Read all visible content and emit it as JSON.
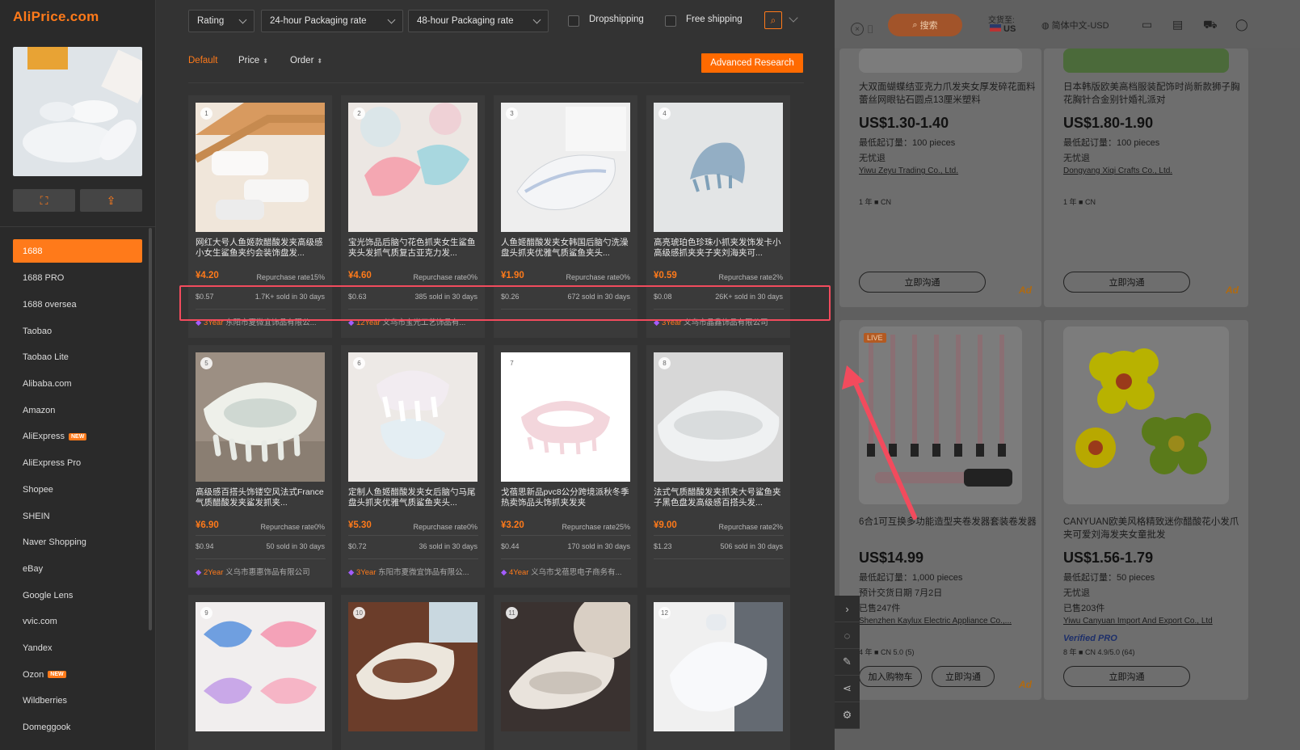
{
  "app": {
    "logo": "AliPrice.com"
  },
  "filters": {
    "rating": "Rating",
    "pack24": "24-hour Packaging rate",
    "pack48": "48-hour Packaging rate",
    "dropshipping": "Dropshipping",
    "free_shipping": "Free shipping"
  },
  "sort": {
    "default": "Default",
    "price": "Price",
    "order": "Order",
    "advanced": "Advanced Research"
  },
  "sources": [
    {
      "label": "1688",
      "active": true
    },
    {
      "label": "1688 PRO"
    },
    {
      "label": "1688 oversea"
    },
    {
      "label": "Taobao"
    },
    {
      "label": "Taobao Lite"
    },
    {
      "label": "Alibaba.com"
    },
    {
      "label": "Amazon"
    },
    {
      "label": "AliExpress",
      "badge": "NEW"
    },
    {
      "label": "AliExpress Pro"
    },
    {
      "label": "Shopee"
    },
    {
      "label": "SHEIN"
    },
    {
      "label": "Naver Shopping"
    },
    {
      "label": "eBay"
    },
    {
      "label": "Google Lens"
    },
    {
      "label": "vvic.com"
    },
    {
      "label": "Yandex"
    },
    {
      "label": "Ozon",
      "badge": "NEW"
    },
    {
      "label": "Wildberries"
    },
    {
      "label": "Domeggook"
    }
  ],
  "products": [
    {
      "num": "1",
      "title": "网红大号人鱼姬款醋酸发夹高级感小女生鲨鱼夹约会装饰盘发...",
      "price": "¥4.20",
      "repurchase": "Repurchase rate15%",
      "usd": "$0.57",
      "sold": "1.7K+ sold in 30 days",
      "years": "3Year",
      "seller": "东阳市夏微宜饰品有限公..."
    },
    {
      "num": "2",
      "title": "宝光饰品后脑勺花色抓夹女生鲨鱼夹头发抓气质复古亚克力发...",
      "price": "¥4.60",
      "repurchase": "Repurchase rate0%",
      "usd": "$0.63",
      "sold": "385 sold in 30 days",
      "years": "12Year",
      "seller": "义乌市宝光工艺饰品有..."
    },
    {
      "num": "3",
      "title": "人鱼姬醋酸发夹女韩国后脑勺洗澡盘头抓夹优雅气质鲨鱼夹头...",
      "price": "¥1.90",
      "repurchase": "Repurchase rate0%",
      "usd": "$0.26",
      "sold": "672 sold in 30 days",
      "years": "",
      "seller": ""
    },
    {
      "num": "4",
      "title": "高亮琥珀色珍珠小抓夹发饰发卡小高级感抓夹夹子夹刘海夹可...",
      "price": "¥0.59",
      "repurchase": "Repurchase rate2%",
      "usd": "$0.08",
      "sold": "26K+ sold in 30 days",
      "years": "3Year",
      "seller": "义乌市晶鑫饰品有限公司"
    },
    {
      "num": "5",
      "title": "高级感百搭头饰镂空风法式France气质醋酸发夹鲨发抓夹...",
      "price": "¥6.90",
      "repurchase": "Repurchase rate0%",
      "usd": "$0.94",
      "sold": "50 sold in 30 days",
      "years": "2Year",
      "seller": "义乌市惠惠饰品有限公司"
    },
    {
      "num": "6",
      "title": "定制人鱼姬醋酸发夹女后脑勺马尾盘头抓夹优雅气质鲨鱼夹头...",
      "price": "¥5.30",
      "repurchase": "Repurchase rate0%",
      "usd": "$0.72",
      "sold": "36 sold in 30 days",
      "years": "3Year",
      "seller": "东阳市夏微宜饰品有限公..."
    },
    {
      "num": "7",
      "title": "戈蓓思新品pvc8公分跨境派秋冬季热卖饰品头饰抓夹发夹",
      "price": "¥3.20",
      "repurchase": "Repurchase rate25%",
      "usd": "$0.44",
      "sold": "170 sold in 30 days",
      "years": "4Year",
      "seller": "义乌市戈蓓思电子商务有..."
    },
    {
      "num": "8",
      "title": "法式气质醋酸发夹抓夹大号鲨鱼夹子黑色盘发高级感百搭头发...",
      "price": "¥9.00",
      "repurchase": "Repurchase rate2%",
      "usd": "$1.23",
      "sold": "506 sold in 30 days",
      "years": "",
      "seller": ""
    },
    {
      "num": "9"
    },
    {
      "num": "10"
    },
    {
      "num": "11"
    },
    {
      "num": "12"
    }
  ],
  "web": {
    "search_btn": "搜索",
    "ship_to": "交货至:",
    "country": "US",
    "language": "简体中文-USD",
    "cards": [
      {
        "title": "大双面蝴蝶结亚克力爪发夹女厚发碎花面料蕾丝网眼钻石圆点13厘米塑料",
        "price": "US$1.30-1.40",
        "moq": "最低起订量：100 pieces",
        "note": "无忧退",
        "company": "Yiwu Zeyu Trading Co., Ltd.",
        "meta": "1 年 ■ CN",
        "btn": "立即沟通",
        "ad": "Ad"
      },
      {
        "title": "日本韩版欧美高档服装配饰时尚新款狮子胸花胸针合金别针婚礼派对",
        "price": "US$1.80-1.90",
        "moq": "最低起订量：100 pieces",
        "note": "无忧退",
        "company": "Dongyang Xiqi Crafts Co., Ltd.",
        "meta": "1 年 ■ CN",
        "btn": "立即沟通",
        "ad": "Ad"
      },
      {
        "title": "6合1可互换多功能造型夹卷发器套装卷发器",
        "price": "US$14.99",
        "moq": "最低起订量：1,000 pieces",
        "note": "预计交货日期 7月2日",
        "sold": "已售247件",
        "company": "Shenzhen Kaylux Electric Appliance Co.,...",
        "meta": "4 年 ■ CN 5.0 (5)",
        "btn1": "加入购物车",
        "btn": "立即沟通",
        "ad": "Ad",
        "live": "LIVE"
      },
      {
        "title": "CANYUAN欧美风格精致迷你醋酸花小发爪夹可爱刘海发夹女童批发",
        "price": "US$1.56-1.79",
        "moq": "最低起订量：50 pieces",
        "note": "无忧退",
        "sold": "已售203件",
        "company": "Yiwu Canyuan Import And Export Co., Ltd",
        "verified": "Verified PRO",
        "meta": "8 年 ■ CN 4.9/5.0 (64)",
        "btn": "立即沟通"
      }
    ]
  },
  "colors": {
    "accent": "#ff7a1a",
    "highlight": "#f24b5d"
  }
}
